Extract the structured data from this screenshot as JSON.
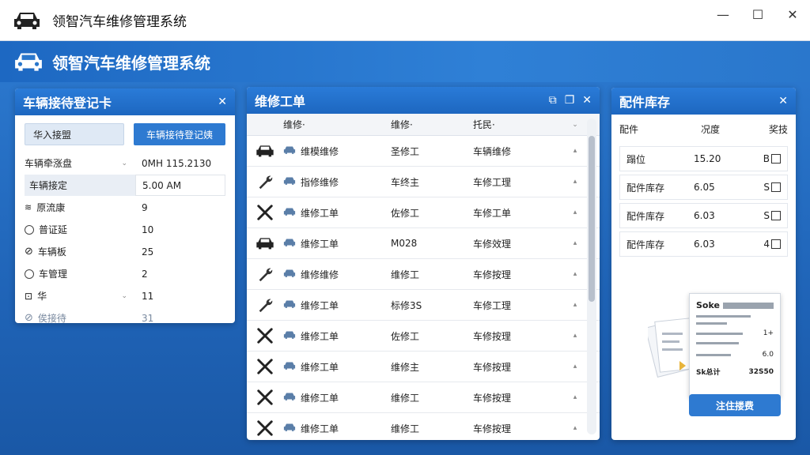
{
  "window": {
    "title": "领智汽车维修管理系统",
    "minimize": "—",
    "maximize": "☐",
    "close": "✕"
  },
  "app": {
    "title": "领智汽车维修管理系统"
  },
  "reception": {
    "title": "车辆接待登记卡",
    "close": "✕",
    "button_secondary": "华入接盟",
    "button_primary": "车辆接待登记姨",
    "fields": [
      {
        "label": "车辆牵涨盘",
        "value": "0MH 115.2130",
        "dropdown": "⌄"
      },
      {
        "label": "车辆接定",
        "value": "5.00 AM"
      },
      {
        "label": "原流康",
        "value": "9"
      },
      {
        "label": "普证延",
        "value": "10"
      },
      {
        "label": "车辆板",
        "value": "25"
      },
      {
        "label": "车管理",
        "value": "2"
      },
      {
        "label": "华",
        "value": "11",
        "dropdown": "⌄"
      },
      {
        "label": "俟接待",
        "value": "31"
      }
    ]
  },
  "orders": {
    "title": "维修工单",
    "btn_a": "⧉",
    "btn_b": "❐",
    "close": "✕",
    "headers": [
      "维修·",
      "维修·",
      "托民·"
    ],
    "header_dd": "⌄",
    "rows": [
      {
        "icon": "car",
        "name": "维模维修",
        "worker": "圣修工",
        "status": "车辆维修"
      },
      {
        "icon": "wrench",
        "name": "指修维修",
        "worker": "车终主",
        "status": "车修工理"
      },
      {
        "icon": "tools",
        "name": "维修工单",
        "worker": "佐修工",
        "status": "车修工单"
      },
      {
        "icon": "car",
        "name": "维修工单",
        "worker": "M028",
        "status": "车修效理"
      },
      {
        "icon": "wrench",
        "name": "维修维修",
        "worker": "维修工",
        "status": "车修按理"
      },
      {
        "icon": "wrench",
        "name": "维修工单",
        "worker": "标修3S",
        "status": "车修工理"
      },
      {
        "icon": "tools",
        "name": "维修工单",
        "worker": "佐修工",
        "status": "车修按理"
      },
      {
        "icon": "tools",
        "name": "维修工单",
        "worker": "维修主",
        "status": "车修按理"
      },
      {
        "icon": "tools",
        "name": "维修工单",
        "worker": "维修工",
        "status": "车修按理"
      },
      {
        "icon": "tools",
        "name": "维修工单",
        "worker": "维修工",
        "status": "车修按理"
      }
    ],
    "row_marker": "▴"
  },
  "parts": {
    "title": "配件库存",
    "close": "✕",
    "headers": [
      "配件",
      "况度",
      "奖技"
    ],
    "rows": [
      {
        "name": "蹋位",
        "qty": "15.20",
        "flag": "B"
      },
      {
        "name": "配件库存",
        "qty": "6.05",
        "flag": "S"
      },
      {
        "name": "配件库存",
        "qty": "6.03",
        "flag": "S"
      },
      {
        "name": "配件库存",
        "qty": "6.03",
        "flag": "4"
      }
    ],
    "receipt": {
      "title": "Soke",
      "amount_a": "1+",
      "amount_b": "6.0",
      "footer_label": "Sk总计",
      "footer_value": "32S50"
    },
    "pay_button": "注住搂费"
  }
}
